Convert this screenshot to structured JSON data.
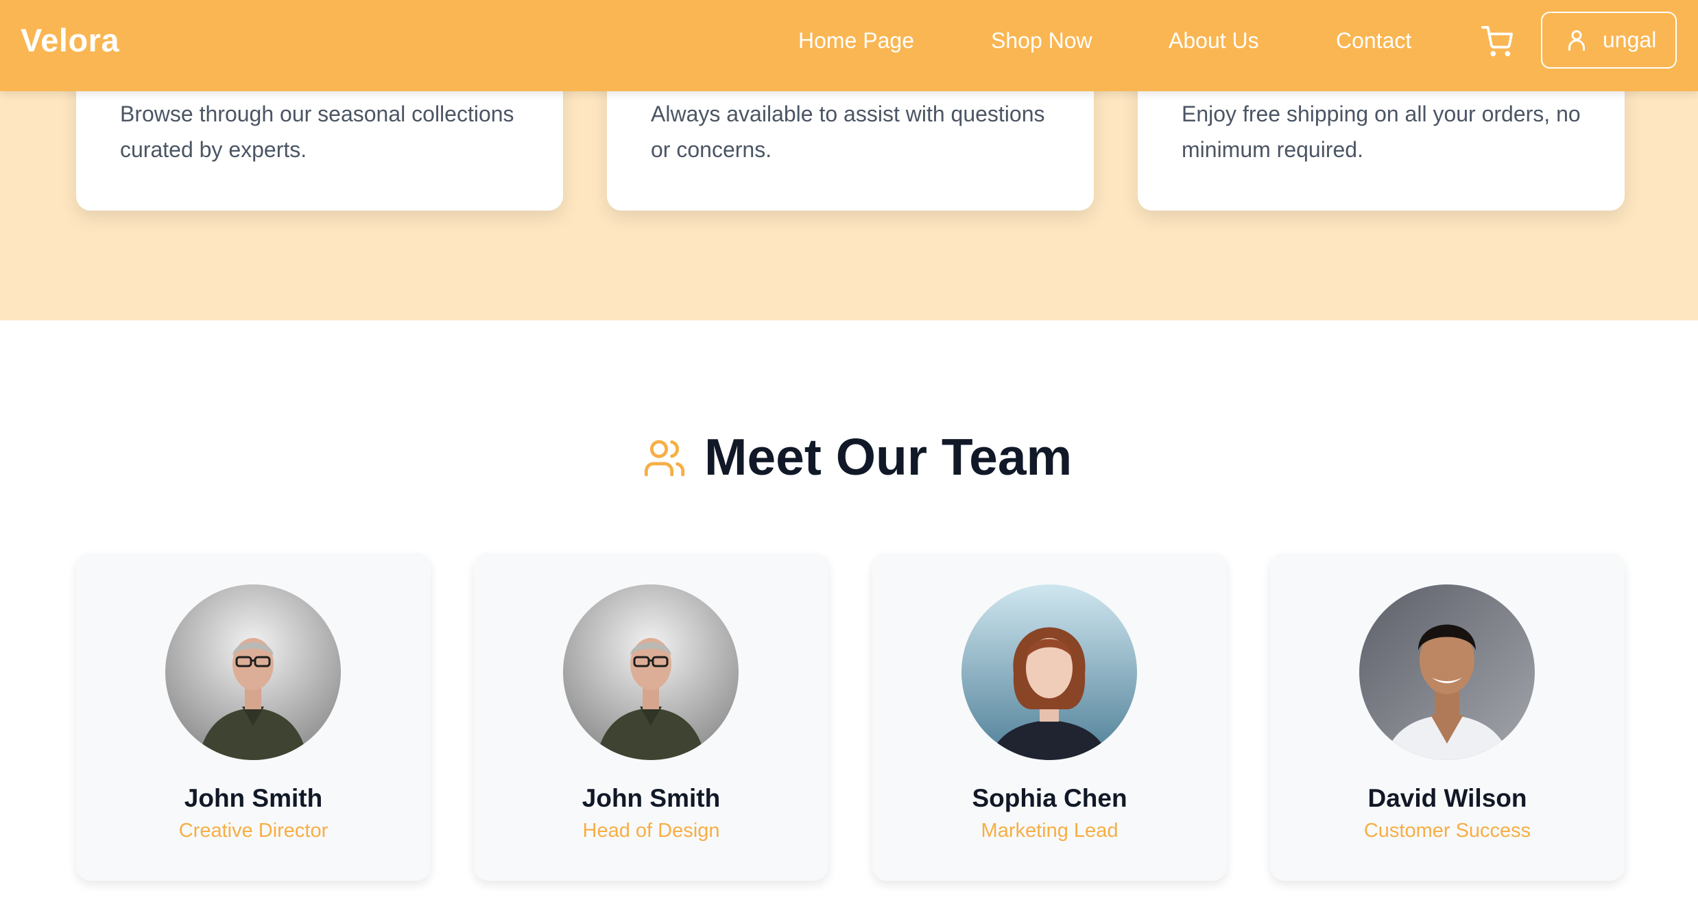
{
  "header": {
    "logo": "Velora",
    "nav": [
      {
        "label": "Home Page"
      },
      {
        "label": "Shop Now"
      },
      {
        "label": "About Us"
      },
      {
        "label": "Contact"
      }
    ],
    "cart_icon": "shopping-cart-icon",
    "user": {
      "icon": "user-icon",
      "name": "ungal"
    }
  },
  "features": [
    {
      "text": "Browse through our seasonal collections curated by experts."
    },
    {
      "text": "Always available to assist with questions or concerns."
    },
    {
      "text": "Enjoy free shipping on all your orders, no minimum required."
    }
  ],
  "team": {
    "icon": "users-icon",
    "title": "Meet Our Team",
    "members": [
      {
        "name": "John Smith",
        "role": "Creative Director"
      },
      {
        "name": "John Smith",
        "role": "Head of Design"
      },
      {
        "name": "Sophia Chen",
        "role": "Marketing Lead"
      },
      {
        "name": "David Wilson",
        "role": "Customer Success"
      }
    ]
  },
  "colors": {
    "header_bg": "#fab652",
    "band_bg": "#fee6c1",
    "accent": "#f6ae45",
    "heading": "#111827",
    "body_text": "#4b5563"
  }
}
